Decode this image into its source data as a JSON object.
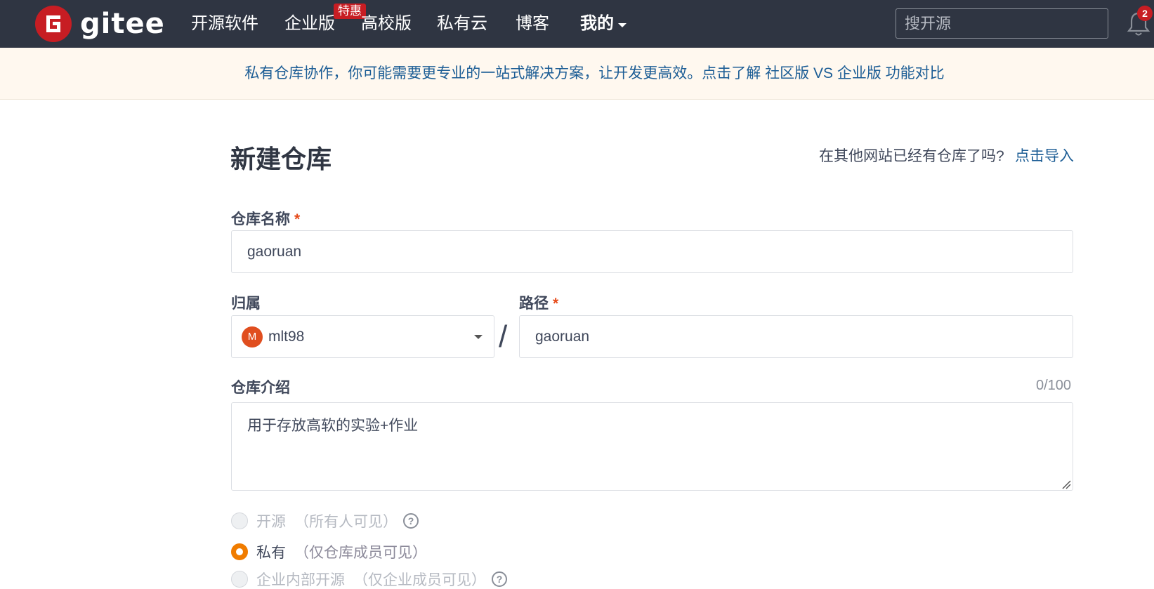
{
  "nav": {
    "logo_text": "gitee",
    "items": [
      "开源软件",
      "企业版",
      "高校版",
      "私有云",
      "博客"
    ],
    "badge": "特惠",
    "mine": "我的",
    "search_placeholder": "搜开源",
    "notification_count": "2"
  },
  "banner": {
    "text": "私有仓库协作，你可能需要更专业的一站式解决方案，让开发更高效。点击了解 社区版 VS 企业版 功能对比"
  },
  "form": {
    "title": "新建仓库",
    "import_question": "在其他网站已经有仓库了吗?",
    "import_link": "点击导入",
    "repo_name_label": "仓库名称",
    "required_mark": "*",
    "repo_name_value": "gaoruan",
    "owner_label": "归属",
    "owner_avatar": "M",
    "owner_value": "mlt98",
    "separator": "/",
    "path_label": "路径",
    "path_value": "gaoruan",
    "desc_label": "仓库介绍",
    "desc_counter": "0/100",
    "desc_value": "用于存放高软的实验+作业",
    "visibility": [
      {
        "label": "开源",
        "hint": "（所有人可见）",
        "checked": false,
        "disabled": true,
        "help": "?"
      },
      {
        "label": "私有",
        "hint": "（仅仓库成员可见）",
        "checked": true,
        "disabled": false
      },
      {
        "label": "企业内部开源",
        "hint": "（仅企业成员可见）",
        "checked": false,
        "disabled": true,
        "help": "?"
      }
    ]
  },
  "colors": {
    "topbar": "#2f3542",
    "brand_red": "#c71d23",
    "link_blue": "#1c5d95",
    "radio_orange": "#f07c00",
    "banner_bg": "#fff8ef"
  }
}
